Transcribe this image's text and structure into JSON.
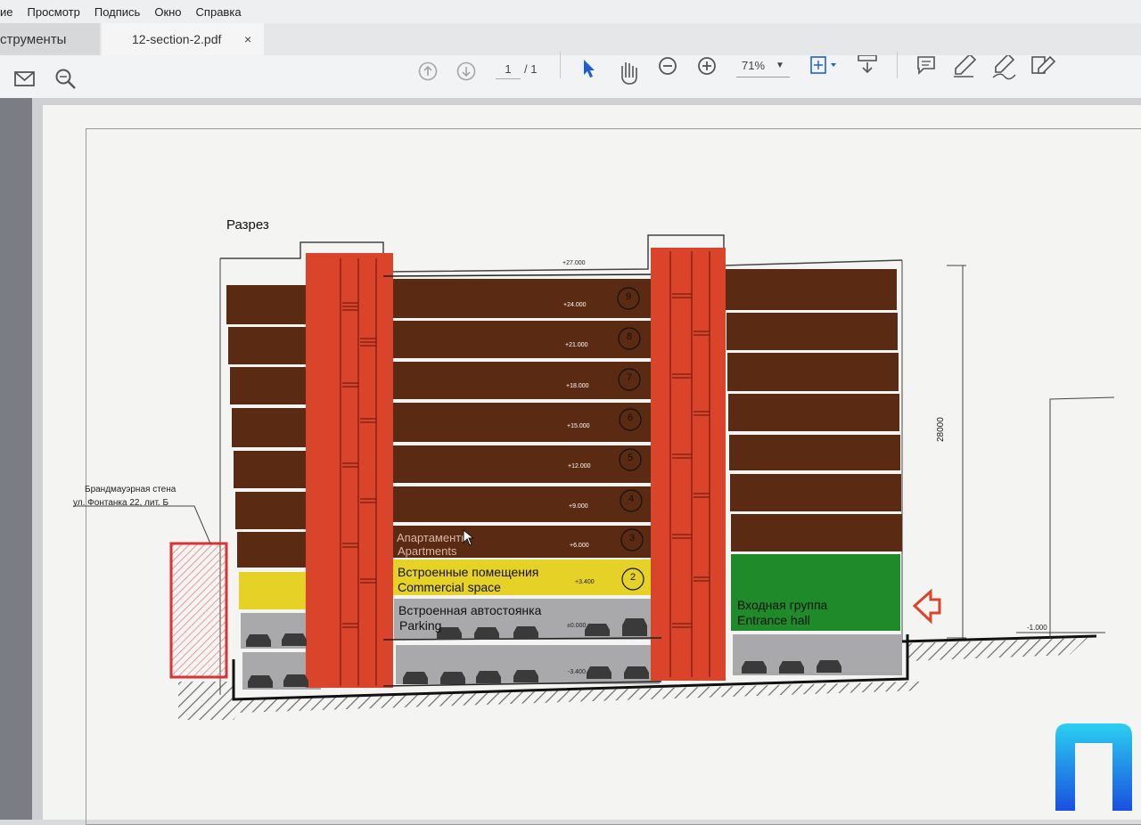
{
  "menu": {
    "items": [
      "ие",
      "Просмотр",
      "Подпись",
      "Окно",
      "Справка"
    ]
  },
  "tabs": {
    "tools": "струменты",
    "document": "12-section-2.pdf",
    "close": "×"
  },
  "toolbar": {
    "page_current": "1",
    "page_total": "/ 1",
    "zoom": "71%"
  },
  "drawing": {
    "title": "Разрез",
    "firewall_label_1": "Брандмауэрная стена",
    "firewall_label_2": "ул. Фонтанка 22, лит. Б",
    "apartments_ru": "Апартаменты",
    "apartments_en": "Apartments",
    "commercial_ru": "Встроенные помещения",
    "commercial_en": "Commercial space",
    "parking_ru": "Встроенная автостоянка",
    "parking_en": "Parking",
    "entrance_ru": "Входная группа",
    "entrance_en": "Entrance hall",
    "height_dim": "28000",
    "ground_level": "-1.000",
    "levels": [
      "+27.000",
      "+24.000",
      "+21.000",
      "+18.000",
      "+15.000",
      "+12.000",
      "+9.000",
      "+6.000",
      "+3.400",
      "±0.000",
      "-3.400"
    ],
    "floors": [
      "9",
      "8",
      "7",
      "6",
      "5",
      "4",
      "3",
      "2"
    ]
  },
  "colors": {
    "apartment": "#5a2a12",
    "core": "#d9442a",
    "commercial": "#e6d227",
    "entrance": "#1f8a2a",
    "parking": "#a9a9ab",
    "firewall": "#d93434"
  }
}
